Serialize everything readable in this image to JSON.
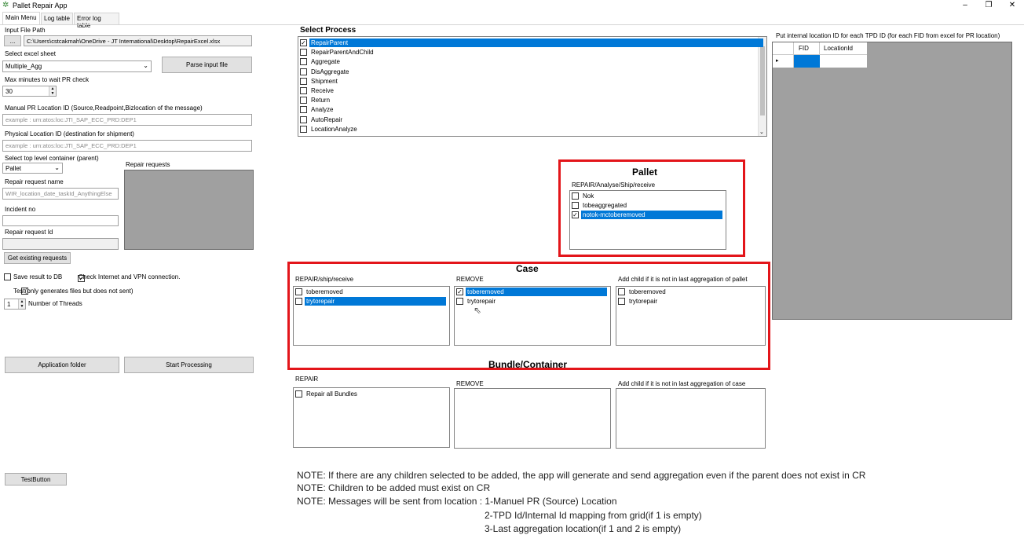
{
  "app": {
    "title": "Pallet Repair App"
  },
  "window_controls": {
    "minimize": "–",
    "maximize": "❐",
    "close": "✕"
  },
  "tabs": [
    "Main Menu",
    "Log table",
    "Error log table"
  ],
  "left": {
    "input_file_label": "Input File Path",
    "browse_label": "...",
    "input_file_value": "C:\\Users\\cstcakmah\\OneDrive - JT International\\Desktop\\RepairExcel.xlsx",
    "excel_sheet_label": "Select excel sheet",
    "excel_sheet_value": "Multiple_Agg",
    "parse_button": "Parse input file",
    "max_minutes_label": "Max minutes to wait PR check",
    "max_minutes_value": "30",
    "manual_pr_label": "Manual PR Location ID (Source,Readpoint,Bizlocation of the message)",
    "manual_pr_placeholder": "example : urn:atos:loc:JTI_SAP_ECC_PRD:DEP1",
    "physical_loc_label": "Physical Location ID (destination for shipment)",
    "physical_loc_placeholder": "example : urn:atos:loc:JTI_SAP_ECC_PRD:DEP1",
    "top_container_label": "Select top level container (parent)",
    "top_container_value": "Pallet",
    "repair_name_label": "Repair request name",
    "repair_name_placeholder": "WIR_location_date_taskId_AnythingElse",
    "incident_label": "Incident no",
    "incident_value": "",
    "repair_id_label": "Repair request Id",
    "repair_id_value": "",
    "get_existing_button": "Get existing requests",
    "save_db_label": "Save result to DB",
    "save_db_checked": false,
    "check_internet_label": "Check Internet and VPN connection.",
    "check_internet_checked": true,
    "test_label": "Test(only generates files but does not sent)",
    "test_checked": false,
    "threads_value": "1",
    "threads_label": "Number of Threads",
    "app_folder_button": "Application folder",
    "start_button": "Start Processing",
    "test_button": "TestButton"
  },
  "repair_requests_label": "Repair requests",
  "select_process": {
    "heading": "Select Process",
    "items": [
      {
        "label": "RepairParent",
        "checked": true,
        "selected": true
      },
      {
        "label": "RepairParentAndChild",
        "checked": false,
        "selected": false
      },
      {
        "label": "Aggregate",
        "checked": false,
        "selected": false
      },
      {
        "label": "DisAggregate",
        "checked": false,
        "selected": false
      },
      {
        "label": "Shipment",
        "checked": false,
        "selected": false
      },
      {
        "label": "Receive",
        "checked": false,
        "selected": false
      },
      {
        "label": "Return",
        "checked": false,
        "selected": false
      },
      {
        "label": "Analyze",
        "checked": false,
        "selected": false
      },
      {
        "label": "AutoRepair",
        "checked": false,
        "selected": false
      },
      {
        "label": "LocationAnalyze",
        "checked": false,
        "selected": false
      }
    ]
  },
  "grid": {
    "label": "Put internal location ID for each TPD ID (for each FID from excel for PR location)",
    "columns": [
      "FID",
      "LocationId"
    ],
    "row_marker": "▸"
  },
  "pallet": {
    "heading": "Pallet",
    "sublabel": "REPAIR/Analyse/Ship/receive",
    "items": [
      {
        "label": "Nok",
        "checked": false,
        "selected": false
      },
      {
        "label": "tobeaggregated",
        "checked": false,
        "selected": false
      },
      {
        "label": "notok-mctoberemoved",
        "checked": true,
        "selected": true
      }
    ]
  },
  "case": {
    "heading": "Case",
    "col1_label": "REPAIR/ship/receive",
    "col1_items": [
      {
        "label": "toberemoved",
        "checked": false,
        "selected": false
      },
      {
        "label": "trytorepair",
        "checked": false,
        "selected": true
      }
    ],
    "col2_label": "REMOVE",
    "col2_items": [
      {
        "label": "toberemoved",
        "checked": true,
        "selected": true
      },
      {
        "label": "trytorepair",
        "checked": false,
        "selected": false
      }
    ],
    "col3_label": "Add child if it is not in last aggregation of pallet",
    "col3_items": [
      {
        "label": "toberemoved",
        "checked": false,
        "selected": false
      },
      {
        "label": "trytorepair",
        "checked": false,
        "selected": false
      }
    ]
  },
  "bundle": {
    "heading": "Bundle/Container",
    "col1_label": "REPAIR",
    "col1_items": [
      {
        "label": "Repair all Bundles",
        "checked": false,
        "selected": false
      }
    ],
    "col2_label": "REMOVE",
    "col3_label": "Add child if it is not in last aggregation of case"
  },
  "notes": [
    "NOTE: If there are any children selected to be added, the app will generate and send aggregation even if the parent does not exist in CR",
    "NOTE: Children to be added must exist on CR",
    "NOTE: Messages will be sent from location : 1-Manuel PR (Source) Location",
    "2-TPD Id/Internal Id mapping from grid(if 1 is empty)",
    "3-Last aggregation location(if 1 and 2 is empty)"
  ],
  "colors": {
    "selection": "#0078d7",
    "highlight_border": "#e3151a",
    "panel_gray": "#a0a0a0"
  }
}
